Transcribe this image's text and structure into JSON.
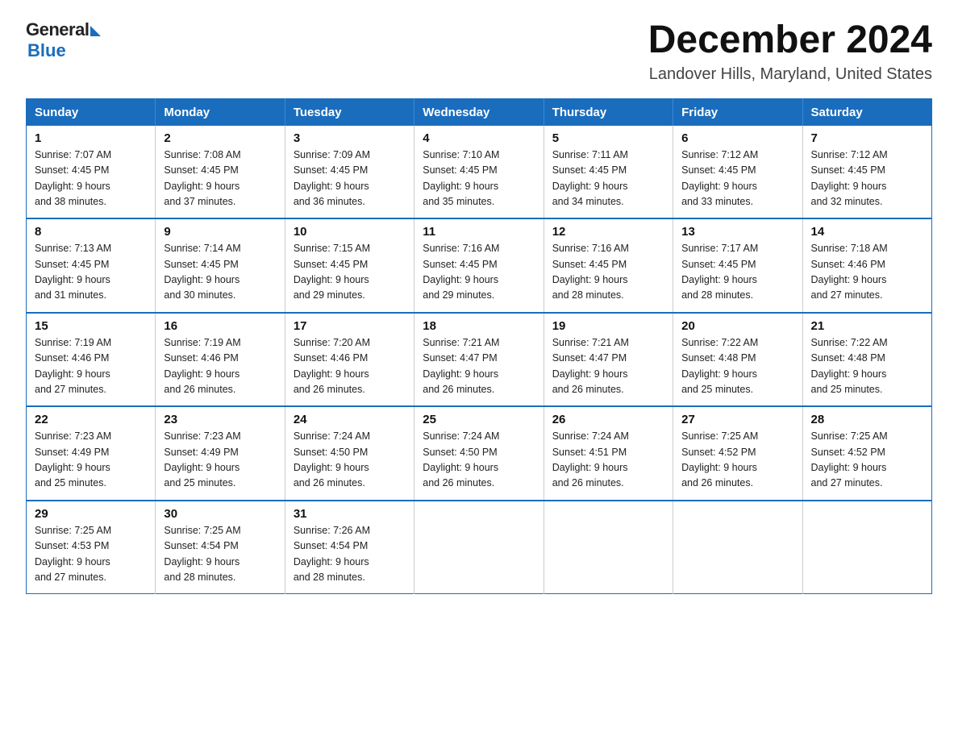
{
  "header": {
    "logo_general": "General",
    "logo_blue": "Blue",
    "month_title": "December 2024",
    "location": "Landover Hills, Maryland, United States"
  },
  "days_of_week": [
    "Sunday",
    "Monday",
    "Tuesday",
    "Wednesday",
    "Thursday",
    "Friday",
    "Saturday"
  ],
  "weeks": [
    [
      {
        "day": "1",
        "sunrise": "7:07 AM",
        "sunset": "4:45 PM",
        "daylight": "9 hours and 38 minutes."
      },
      {
        "day": "2",
        "sunrise": "7:08 AM",
        "sunset": "4:45 PM",
        "daylight": "9 hours and 37 minutes."
      },
      {
        "day": "3",
        "sunrise": "7:09 AM",
        "sunset": "4:45 PM",
        "daylight": "9 hours and 36 minutes."
      },
      {
        "day": "4",
        "sunrise": "7:10 AM",
        "sunset": "4:45 PM",
        "daylight": "9 hours and 35 minutes."
      },
      {
        "day": "5",
        "sunrise": "7:11 AM",
        "sunset": "4:45 PM",
        "daylight": "9 hours and 34 minutes."
      },
      {
        "day": "6",
        "sunrise": "7:12 AM",
        "sunset": "4:45 PM",
        "daylight": "9 hours and 33 minutes."
      },
      {
        "day": "7",
        "sunrise": "7:12 AM",
        "sunset": "4:45 PM",
        "daylight": "9 hours and 32 minutes."
      }
    ],
    [
      {
        "day": "8",
        "sunrise": "7:13 AM",
        "sunset": "4:45 PM",
        "daylight": "9 hours and 31 minutes."
      },
      {
        "day": "9",
        "sunrise": "7:14 AM",
        "sunset": "4:45 PM",
        "daylight": "9 hours and 30 minutes."
      },
      {
        "day": "10",
        "sunrise": "7:15 AM",
        "sunset": "4:45 PM",
        "daylight": "9 hours and 29 minutes."
      },
      {
        "day": "11",
        "sunrise": "7:16 AM",
        "sunset": "4:45 PM",
        "daylight": "9 hours and 29 minutes."
      },
      {
        "day": "12",
        "sunrise": "7:16 AM",
        "sunset": "4:45 PM",
        "daylight": "9 hours and 28 minutes."
      },
      {
        "day": "13",
        "sunrise": "7:17 AM",
        "sunset": "4:45 PM",
        "daylight": "9 hours and 28 minutes."
      },
      {
        "day": "14",
        "sunrise": "7:18 AM",
        "sunset": "4:46 PM",
        "daylight": "9 hours and 27 minutes."
      }
    ],
    [
      {
        "day": "15",
        "sunrise": "7:19 AM",
        "sunset": "4:46 PM",
        "daylight": "9 hours and 27 minutes."
      },
      {
        "day": "16",
        "sunrise": "7:19 AM",
        "sunset": "4:46 PM",
        "daylight": "9 hours and 26 minutes."
      },
      {
        "day": "17",
        "sunrise": "7:20 AM",
        "sunset": "4:46 PM",
        "daylight": "9 hours and 26 minutes."
      },
      {
        "day": "18",
        "sunrise": "7:21 AM",
        "sunset": "4:47 PM",
        "daylight": "9 hours and 26 minutes."
      },
      {
        "day": "19",
        "sunrise": "7:21 AM",
        "sunset": "4:47 PM",
        "daylight": "9 hours and 26 minutes."
      },
      {
        "day": "20",
        "sunrise": "7:22 AM",
        "sunset": "4:48 PM",
        "daylight": "9 hours and 25 minutes."
      },
      {
        "day": "21",
        "sunrise": "7:22 AM",
        "sunset": "4:48 PM",
        "daylight": "9 hours and 25 minutes."
      }
    ],
    [
      {
        "day": "22",
        "sunrise": "7:23 AM",
        "sunset": "4:49 PM",
        "daylight": "9 hours and 25 minutes."
      },
      {
        "day": "23",
        "sunrise": "7:23 AM",
        "sunset": "4:49 PM",
        "daylight": "9 hours and 25 minutes."
      },
      {
        "day": "24",
        "sunrise": "7:24 AM",
        "sunset": "4:50 PM",
        "daylight": "9 hours and 26 minutes."
      },
      {
        "day": "25",
        "sunrise": "7:24 AM",
        "sunset": "4:50 PM",
        "daylight": "9 hours and 26 minutes."
      },
      {
        "day": "26",
        "sunrise": "7:24 AM",
        "sunset": "4:51 PM",
        "daylight": "9 hours and 26 minutes."
      },
      {
        "day": "27",
        "sunrise": "7:25 AM",
        "sunset": "4:52 PM",
        "daylight": "9 hours and 26 minutes."
      },
      {
        "day": "28",
        "sunrise": "7:25 AM",
        "sunset": "4:52 PM",
        "daylight": "9 hours and 27 minutes."
      }
    ],
    [
      {
        "day": "29",
        "sunrise": "7:25 AM",
        "sunset": "4:53 PM",
        "daylight": "9 hours and 27 minutes."
      },
      {
        "day": "30",
        "sunrise": "7:25 AM",
        "sunset": "4:54 PM",
        "daylight": "9 hours and 28 minutes."
      },
      {
        "day": "31",
        "sunrise": "7:26 AM",
        "sunset": "4:54 PM",
        "daylight": "9 hours and 28 minutes."
      },
      null,
      null,
      null,
      null
    ]
  ],
  "labels": {
    "sunrise": "Sunrise:",
    "sunset": "Sunset:",
    "daylight": "Daylight:"
  }
}
